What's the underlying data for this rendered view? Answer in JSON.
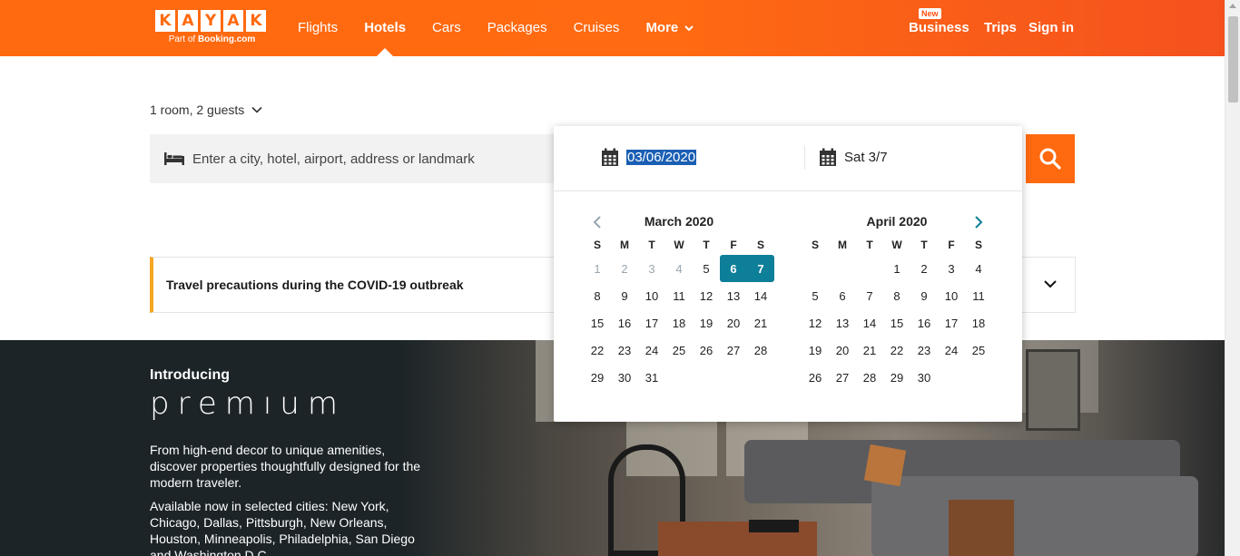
{
  "header": {
    "logo_letters": [
      "K",
      "A",
      "Y",
      "A",
      "K"
    ],
    "logo_sub_prefix": "Part of ",
    "logo_sub_brand": "Booking.com",
    "nav": [
      "Flights",
      "Hotels",
      "Cars",
      "Packages",
      "Cruises",
      "More"
    ],
    "active_nav": "Hotels",
    "new_badge": "New",
    "business": "Business",
    "trips": "Trips",
    "sign_in": "Sign in"
  },
  "search": {
    "guests": "1 room, 2 guests",
    "destination_placeholder": "Enter a city, hotel, airport, address or landmark",
    "search_icon": "search-icon"
  },
  "notice": {
    "text": "Travel precautions during the COVID-19 outbreak"
  },
  "premium": {
    "intro": "Introducing",
    "word": "premıum",
    "description": "From high-end decor to unique amenities, discover properties thoughtfully designed for the modern traveler.",
    "cities": "Available now in selected cities: New York, Chicago, Dallas, Pittsburgh, New Orleans, Houston, Minneapolis, Philadelphia, San Diego and Washington D.C."
  },
  "datepicker": {
    "start_value": "03/06/2020",
    "end_value": "Sat 3/7",
    "days_of_week": [
      "S",
      "M",
      "T",
      "W",
      "T",
      "F",
      "S"
    ],
    "months": [
      {
        "title": "March 2020",
        "weeks": [
          [
            "1",
            "2",
            "3",
            "4",
            "5",
            "6",
            "7"
          ],
          [
            "8",
            "9",
            "10",
            "11",
            "12",
            "13",
            "14"
          ],
          [
            "15",
            "16",
            "17",
            "18",
            "19",
            "20",
            "21"
          ],
          [
            "22",
            "23",
            "24",
            "25",
            "26",
            "27",
            "28"
          ],
          [
            "29",
            "30",
            "31",
            "",
            "",
            "",
            ""
          ]
        ],
        "past": [
          "1",
          "2",
          "3",
          "4"
        ],
        "selected": [
          "6",
          "7"
        ]
      },
      {
        "title": "April 2020",
        "weeks": [
          [
            "",
            "",
            "",
            "1",
            "2",
            "3",
            "4"
          ],
          [
            "5",
            "6",
            "7",
            "8",
            "9",
            "10",
            "11"
          ],
          [
            "12",
            "13",
            "14",
            "15",
            "16",
            "17",
            "18"
          ],
          [
            "19",
            "20",
            "21",
            "22",
            "23",
            "24",
            "25"
          ],
          [
            "26",
            "27",
            "28",
            "29",
            "30",
            "",
            ""
          ]
        ],
        "past": [],
        "selected": []
      }
    ],
    "selected_color": "#0e7f99"
  },
  "colors": {
    "brand": "#ff690f",
    "notice_accent": "#f5a623"
  }
}
